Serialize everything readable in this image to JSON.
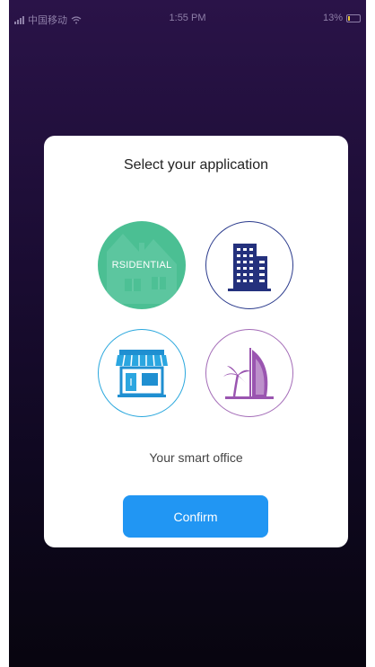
{
  "status_bar": {
    "carrier": "中国移动",
    "time": "1:55 PM",
    "battery": "13%"
  },
  "modal": {
    "title": "Select your application",
    "options": [
      {
        "id": "residential",
        "label": "RSIDENTIAL",
        "icon": "house-icon",
        "selected": true,
        "color": "#4bbf93"
      },
      {
        "id": "office",
        "label": "",
        "icon": "office-building-icon",
        "selected": false,
        "color": "#2a3a8c"
      },
      {
        "id": "retail",
        "label": "",
        "icon": "storefront-icon",
        "selected": false,
        "color": "#29a7dd"
      },
      {
        "id": "hotel",
        "label": "",
        "icon": "burj-al-arab-palm-icon",
        "selected": false,
        "color": "#a36bb7"
      }
    ],
    "description": "Your smart office",
    "confirm_label": "Confirm"
  },
  "colors": {
    "accent": "#2196f3",
    "background_top": "#2a1348",
    "background_bottom": "#08050f"
  }
}
